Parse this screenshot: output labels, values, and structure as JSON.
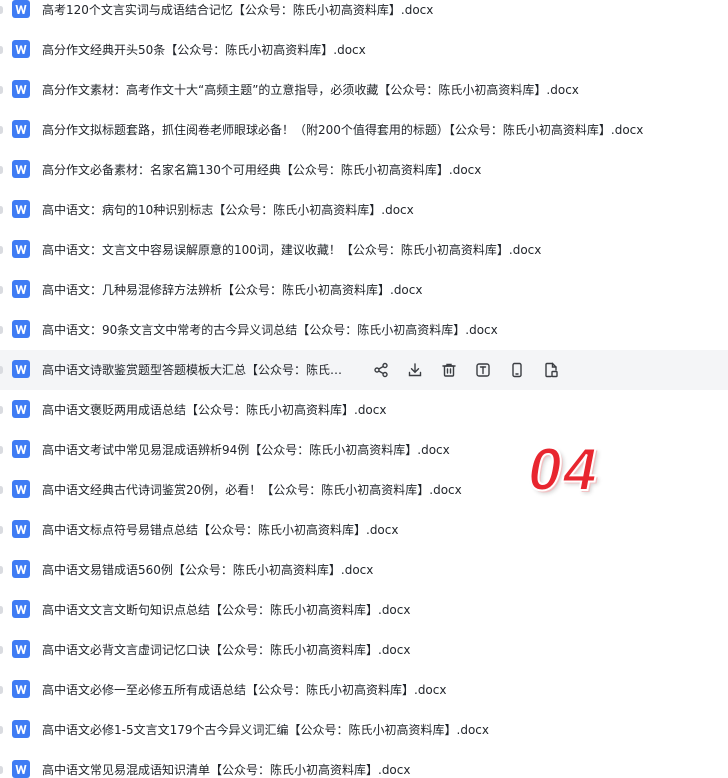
{
  "files": [
    {
      "name": "高考120个文言实词与成语结合记忆【公众号：陈氏小初高资料库】.docx"
    },
    {
      "name": "高分作文经典开头50条【公众号：陈氏小初高资料库】.docx"
    },
    {
      "name": "高分作文素材：高考作文十大“高频主题”的立意指导，必须收藏【公众号：陈氏小初高资料库】.docx"
    },
    {
      "name": "高分作文拟标题套路，抓住阅卷老师眼球必备！（附200个值得套用的标题）【公众号：陈氏小初高资料库】.docx"
    },
    {
      "name": "高分作文必备素材：名家名篇130个可用经典【公众号：陈氏小初高资料库】.docx"
    },
    {
      "name": "高中语文：病句的10种识别标志【公众号：陈氏小初高资料库】.docx"
    },
    {
      "name": "高中语文：文言文中容易误解原意的100词，建议收藏！【公众号：陈氏小初高资料库】.docx"
    },
    {
      "name": "高中语文：几种易混修辞方法辨析【公众号：陈氏小初高资料库】.docx"
    },
    {
      "name": "高中语文：90条文言文中常考的古今异义词总结【公众号：陈氏小初高资料库】.docx"
    },
    {
      "name": "高中语文诗歌鉴赏题型答题模板大汇总【公众号：陈氏小初高资料库】.docx",
      "hovered": true
    },
    {
      "name": "高中语文褒贬两用成语总结【公众号：陈氏小初高资料库】.docx"
    },
    {
      "name": "高中语文考试中常见易混成语辨析94例【公众号：陈氏小初高资料库】.docx"
    },
    {
      "name": "高中语文经典古代诗词鉴赏20例，必看！【公众号：陈氏小初高资料库】.docx"
    },
    {
      "name": "高中语文标点符号易错点总结【公众号：陈氏小初高资料库】.docx"
    },
    {
      "name": "高中语文易错成语560例【公众号：陈氏小初高资料库】.docx"
    },
    {
      "name": "高中语文文言文断句知识点总结【公众号：陈氏小初高资料库】.docx"
    },
    {
      "name": "高中语文必背文言虚词记忆口诀【公众号：陈氏小初高资料库】.docx"
    },
    {
      "name": "高中语文必修一至必修五所有成语总结【公众号：陈氏小初高资料库】.docx"
    },
    {
      "name": "高中语文必修1-5文言文179个古今异义词汇编【公众号：陈氏小初高资料库】.docx"
    },
    {
      "name": "高中语文常见易混成语知识清单【公众号：陈氏小初高资料库】.docx"
    }
  ],
  "row_actions": [
    {
      "icon": "share-icon"
    },
    {
      "icon": "download-icon"
    },
    {
      "icon": "delete-icon"
    },
    {
      "icon": "rename-icon"
    },
    {
      "icon": "mobile-icon"
    },
    {
      "icon": "copy-file-icon"
    }
  ],
  "overlay_badge": "04",
  "colors": {
    "word_icon": "#3f7cf4",
    "hover_row": "#f4f5f7",
    "text": "#1f2329",
    "badge": "#e8262f"
  }
}
